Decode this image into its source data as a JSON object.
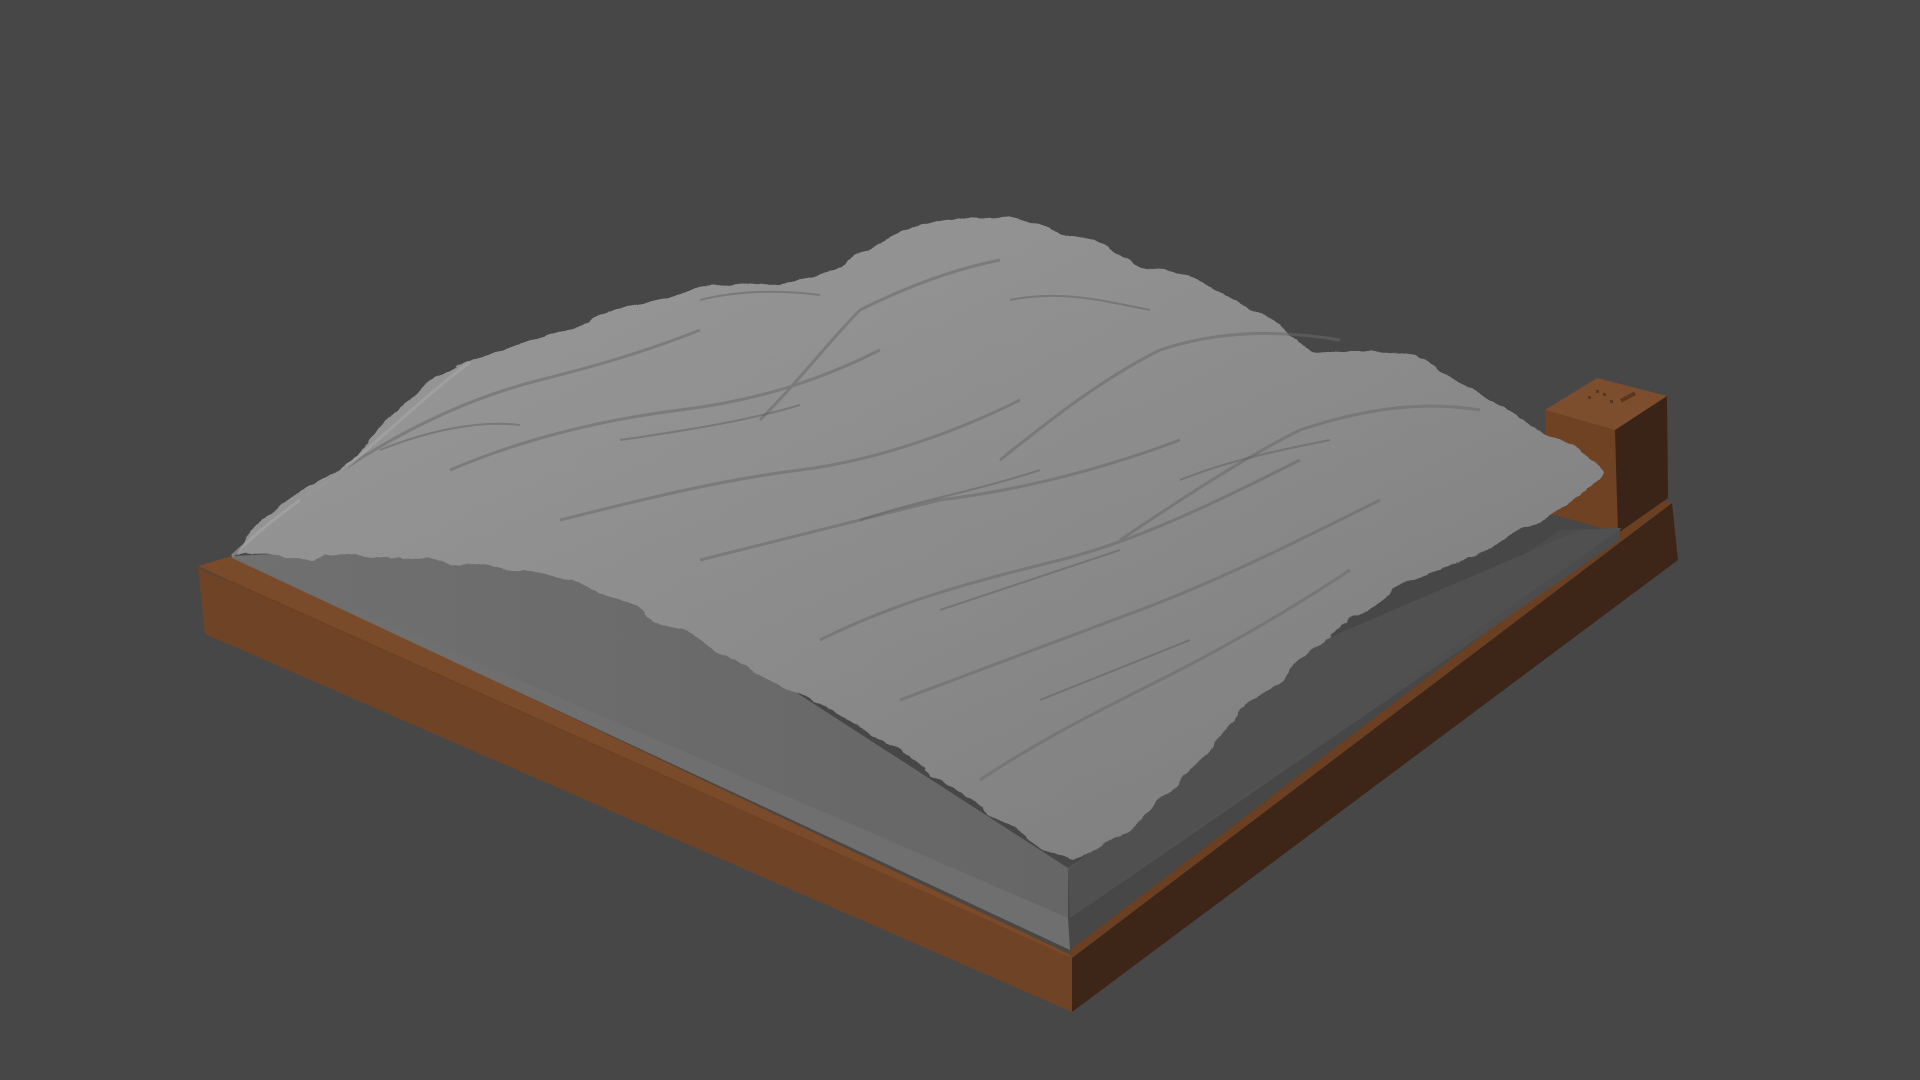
{
  "viewport": {
    "background_color": "#474747"
  },
  "model": {
    "terrain_color": "#8c8c8c",
    "terrain_shadow_color": "#626262",
    "base_fill_color": "#6f6f6f",
    "base_side_shadow_color": "#505050",
    "frame_color": "#714526",
    "frame_dark_color": "#3b2418",
    "frame_top_color": "#7a4a2a",
    "post_icon": "engraved-label-icon"
  }
}
